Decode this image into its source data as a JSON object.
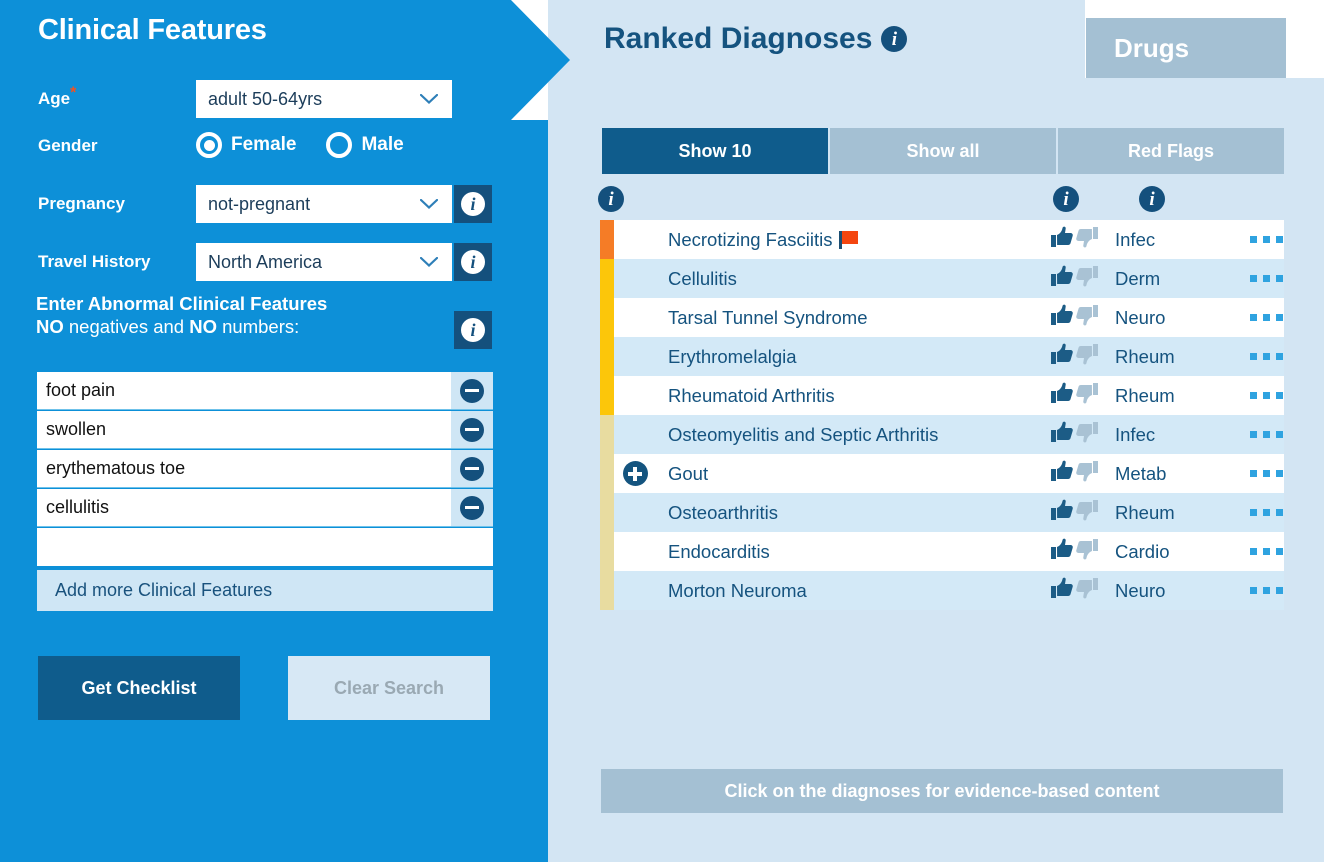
{
  "left": {
    "title": "Clinical Features",
    "age": {
      "label": "Age",
      "required_marker": "*",
      "value": "adult 50-64yrs"
    },
    "gender": {
      "label": "Gender",
      "options": [
        "Female",
        "Male"
      ],
      "selected": "Female"
    },
    "pregnancy": {
      "label": "Pregnancy",
      "value": "not-pregnant",
      "info": "i"
    },
    "travel": {
      "label": "Travel History",
      "value": "North America",
      "info": "i"
    },
    "features_instruction_line1": "Enter Abnormal Clinical Features",
    "features_instruction_line2_a": "NO",
    "features_instruction_line2_b": " negatives and ",
    "features_instruction_line2_c": "NO",
    "features_instruction_line2_d": " numbers:",
    "features_info": "i",
    "features": [
      "foot pain",
      "swollen",
      "erythematous toe",
      "cellulitis"
    ],
    "empty_feature_value": "",
    "empty_feature_placeholder": "",
    "add_more_label": "Add more Clinical Features",
    "get_checklist_label": "Get Checklist",
    "clear_search_label": "Clear Search"
  },
  "right": {
    "title": "Ranked Diagnoses",
    "title_info": "i",
    "drugs_tab_label": "Drugs",
    "tabs": [
      {
        "label": "Show 10",
        "state": "active"
      },
      {
        "label": "Show all",
        "state": "inactive"
      },
      {
        "label": "Red Flags",
        "state": "inactive"
      }
    ],
    "column_info_icons": [
      "i",
      "i",
      "i"
    ],
    "diagnoses": [
      {
        "name": "Necrotizing Fasciitis",
        "category": "Infec",
        "red_flag": true,
        "expandable": false
      },
      {
        "name": "Cellulitis",
        "category": "Derm",
        "red_flag": false,
        "expandable": false
      },
      {
        "name": "Tarsal Tunnel Syndrome",
        "category": "Neuro",
        "red_flag": false,
        "expandable": false
      },
      {
        "name": "Erythromelalgia",
        "category": "Rheum",
        "red_flag": false,
        "expandable": false
      },
      {
        "name": "Rheumatoid Arthritis",
        "category": "Rheum",
        "red_flag": false,
        "expandable": false
      },
      {
        "name": "Osteomyelitis and Septic Arthritis",
        "category": "Infec",
        "red_flag": false,
        "expandable": false
      },
      {
        "name": "Gout",
        "category": "Metab",
        "red_flag": false,
        "expandable": true
      },
      {
        "name": "Osteoarthritis",
        "category": "Rheum",
        "red_flag": false,
        "expandable": false
      },
      {
        "name": "Endocarditis",
        "category": "Cardio",
        "red_flag": false,
        "expandable": false
      },
      {
        "name": "Morton Neuroma",
        "category": "Neuro",
        "red_flag": false,
        "expandable": false
      }
    ],
    "severity_bands": [
      {
        "color": "#F57C26",
        "rows": 1
      },
      {
        "color": "#FCC60A",
        "rows": 4
      },
      {
        "color": "#E8DCA0",
        "rows": 5
      }
    ],
    "bottom_banner": "Click on the diagnoses for evidence-based content"
  },
  "colors": {
    "panel_blue": "#0D90D8",
    "dark_blue": "#14507D",
    "content_bg": "#D3E5F3",
    "tab_inactive": "#A4C0D3",
    "accent_red": "#F44610",
    "thumb_up": "#1C5C86",
    "thumb_down": "#A9C2D4"
  }
}
